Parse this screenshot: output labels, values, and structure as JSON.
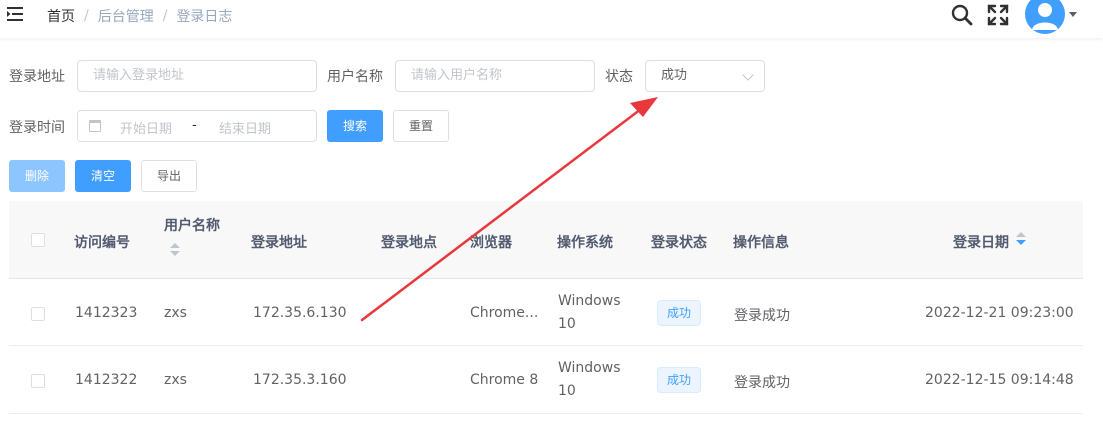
{
  "breadcrumb": [
    "首页",
    "后台管理",
    "登录日志"
  ],
  "breadcrumb_separator": "/",
  "search_form": {
    "ipaddr_label": "登录地址",
    "ipaddr_placeholder": "请输入登录地址",
    "username_label": "用户名称",
    "username_placeholder": "请输入用户名称",
    "status_label": "状态",
    "status_value": "成功",
    "time_label": "登录时间",
    "start_placeholder": "开始日期",
    "range_separator": "-",
    "end_placeholder": "结束日期",
    "search_button": "搜索",
    "reset_button": "重置"
  },
  "toolbar": {
    "delete_button": "删除",
    "clean_button": "清空",
    "export_button": "导出"
  },
  "table": {
    "columns": [
      "访问编号",
      "用户名称",
      "登录地址",
      "登录地点",
      "浏览器",
      "操作系统",
      "登录状态",
      "操作信息",
      "登录日期"
    ],
    "rows": [
      {
        "info_id": "1412323",
        "user_name": "zxs",
        "ipaddr": "172.35.6.130",
        "location": "",
        "browser": "Chrome...",
        "os_line1": "Windows",
        "os_line2": "10",
        "status": "成功",
        "msg": "登录成功",
        "login_time": "2022-12-21 09:23:00"
      },
      {
        "info_id": "1412322",
        "user_name": "zxs",
        "ipaddr": "172.35.3.160",
        "location": "",
        "browser": "Chrome 8",
        "os_line1": "Windows",
        "os_line2": "10",
        "status": "成功",
        "msg": "登录成功",
        "login_time": "2022-12-15 09:14:48"
      }
    ]
  },
  "colors": {
    "primary": "#409eff",
    "annotation_arrow": "#e8383c"
  },
  "icons": {
    "hamburger": "hamburger-icon",
    "search": "search-icon",
    "fullscreen": "fullscreen-icon",
    "avatar": "user-avatar",
    "date": "calendar-icon"
  }
}
